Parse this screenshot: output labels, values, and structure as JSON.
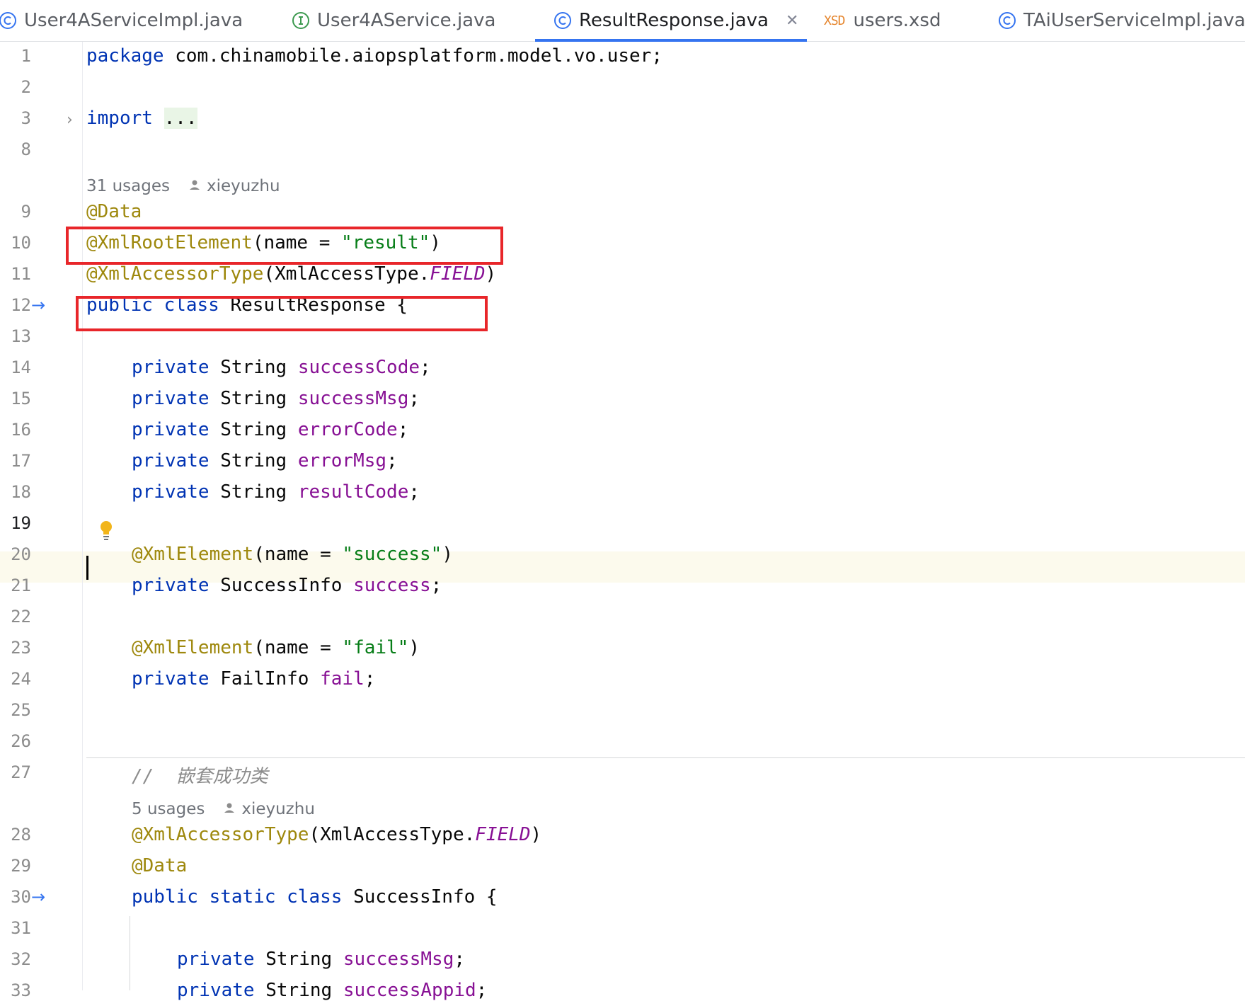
{
  "tabs": [
    {
      "label": "User4AServiceImpl.java",
      "icon": "class-c-icon"
    },
    {
      "label": "User4AService.java",
      "icon": "interface-i-icon"
    },
    {
      "label": "ResultResponse.java",
      "icon": "class-c-icon",
      "active": true
    },
    {
      "label": "users.xsd",
      "icon": "xsd-icon",
      "icon_text": "XSD"
    },
    {
      "label": "TAiUserServiceImpl.java",
      "icon": "class-c-icon"
    }
  ],
  "line_numbers": [
    "1",
    "2",
    "3",
    "8",
    "9",
    "10",
    "11",
    "12",
    "13",
    "14",
    "15",
    "16",
    "17",
    "18",
    "19",
    "20",
    "21",
    "22",
    "23",
    "24",
    "25",
    "26",
    "27",
    "28",
    "29",
    "30",
    "31",
    "32",
    "33"
  ],
  "current_line": "19",
  "hints": {
    "top": {
      "usages": "31 usages",
      "author": "xieyuzhu"
    },
    "nested": {
      "usages": "5 usages",
      "author": "xieyuzhu"
    }
  },
  "code": {
    "l1_kw": "package",
    "l1_rest": " com.chinamobile.aiopsplatform.model.vo.user;",
    "l3_kw": "import",
    "l3_fold": "...",
    "l9": "@Data",
    "l10_ann": "@XmlRootElement",
    "l10_open": "(name = ",
    "l10_str": "\"result\"",
    "l10_close": ")",
    "l11_ann": "@XmlAccessorType",
    "l11_mid": "(XmlAccessType.",
    "l11_enum": "FIELD",
    "l11_close": ")",
    "l12_kw": "public class",
    "l12_rest": " ResultResponse {",
    "private": "private",
    "type_string": " String ",
    "f14": "successCode",
    "f15": "successMsg",
    "f16": "errorCode",
    "f17": "errorMsg",
    "f18": "resultCode",
    "semi": ";",
    "xml_element": "@XmlElement",
    "name_eq": "(name = ",
    "l20_str": "\"success\"",
    "close_paren": ")",
    "l21_type": " SuccessInfo ",
    "l21_field": "success",
    "l23_str": "\"fail\"",
    "l24_type": " FailInfo ",
    "l24_field": "fail",
    "l27_comment": "//  嵌套成功类",
    "l28_ann": "@XmlAccessorType",
    "l28_mid": "(XmlAccessType.",
    "l28_enum": "FIELD",
    "l28_close": ")",
    "l29": "@Data",
    "l30_kw": "public static class",
    "l30_rest": " SuccessInfo {",
    "l32_field": "successMsg",
    "l33_field": "successAppid"
  },
  "colors": {
    "keyword": "#0033b3",
    "annotation": "#9e880d",
    "string": "#067d17",
    "field": "#871094",
    "highlight_box": "#e8262a",
    "tab_underline": "#3574f0"
  }
}
